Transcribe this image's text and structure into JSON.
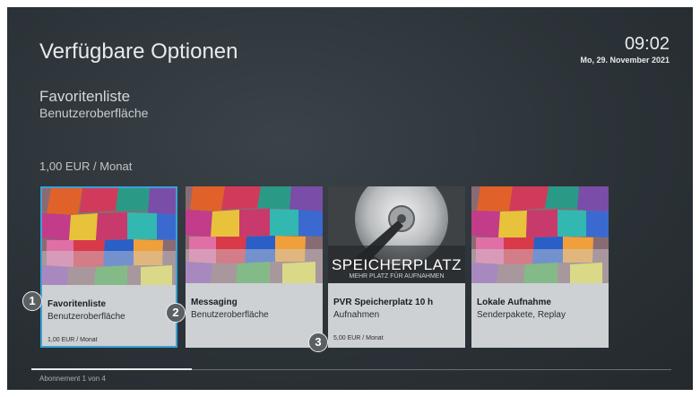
{
  "header": {
    "title": "Verfügbare Optionen",
    "time": "09:02",
    "date": "Mo, 29. November 2021"
  },
  "selection": {
    "name": "Favoritenliste",
    "category": "Benutzeroberfläche",
    "price": "1,00 EUR / Monat"
  },
  "cards": [
    {
      "name": "Favoritenliste",
      "category": "Benutzeroberfläche",
      "price": "1,00 EUR / Monat",
      "image": "colored-blocks"
    },
    {
      "name": "Messaging",
      "category": "Benutzeroberfläche",
      "price": "",
      "image": "colored-blocks"
    },
    {
      "name": "PVR Speicherplatz 10 h",
      "category": "Aufnahmen",
      "price": "5,00 EUR / Monat",
      "image": "hard-drive",
      "image_title": "SPEICHERPLATZ",
      "image_subtitle": "MEHR PLATZ FÜR AUFNAHMEN"
    },
    {
      "name": "Lokale Aufnahme",
      "category": "Senderpakete, Replay",
      "price": "",
      "image": "colored-blocks"
    }
  ],
  "badges": [
    "1",
    "2",
    "3"
  ],
  "footer": {
    "pager": "Abonnement 1 von 4",
    "progress_fraction": 0.25
  },
  "colors": {
    "focus_border": "#3aa1d6",
    "background": "#2c3338",
    "card_background": "#cdd1d3"
  }
}
